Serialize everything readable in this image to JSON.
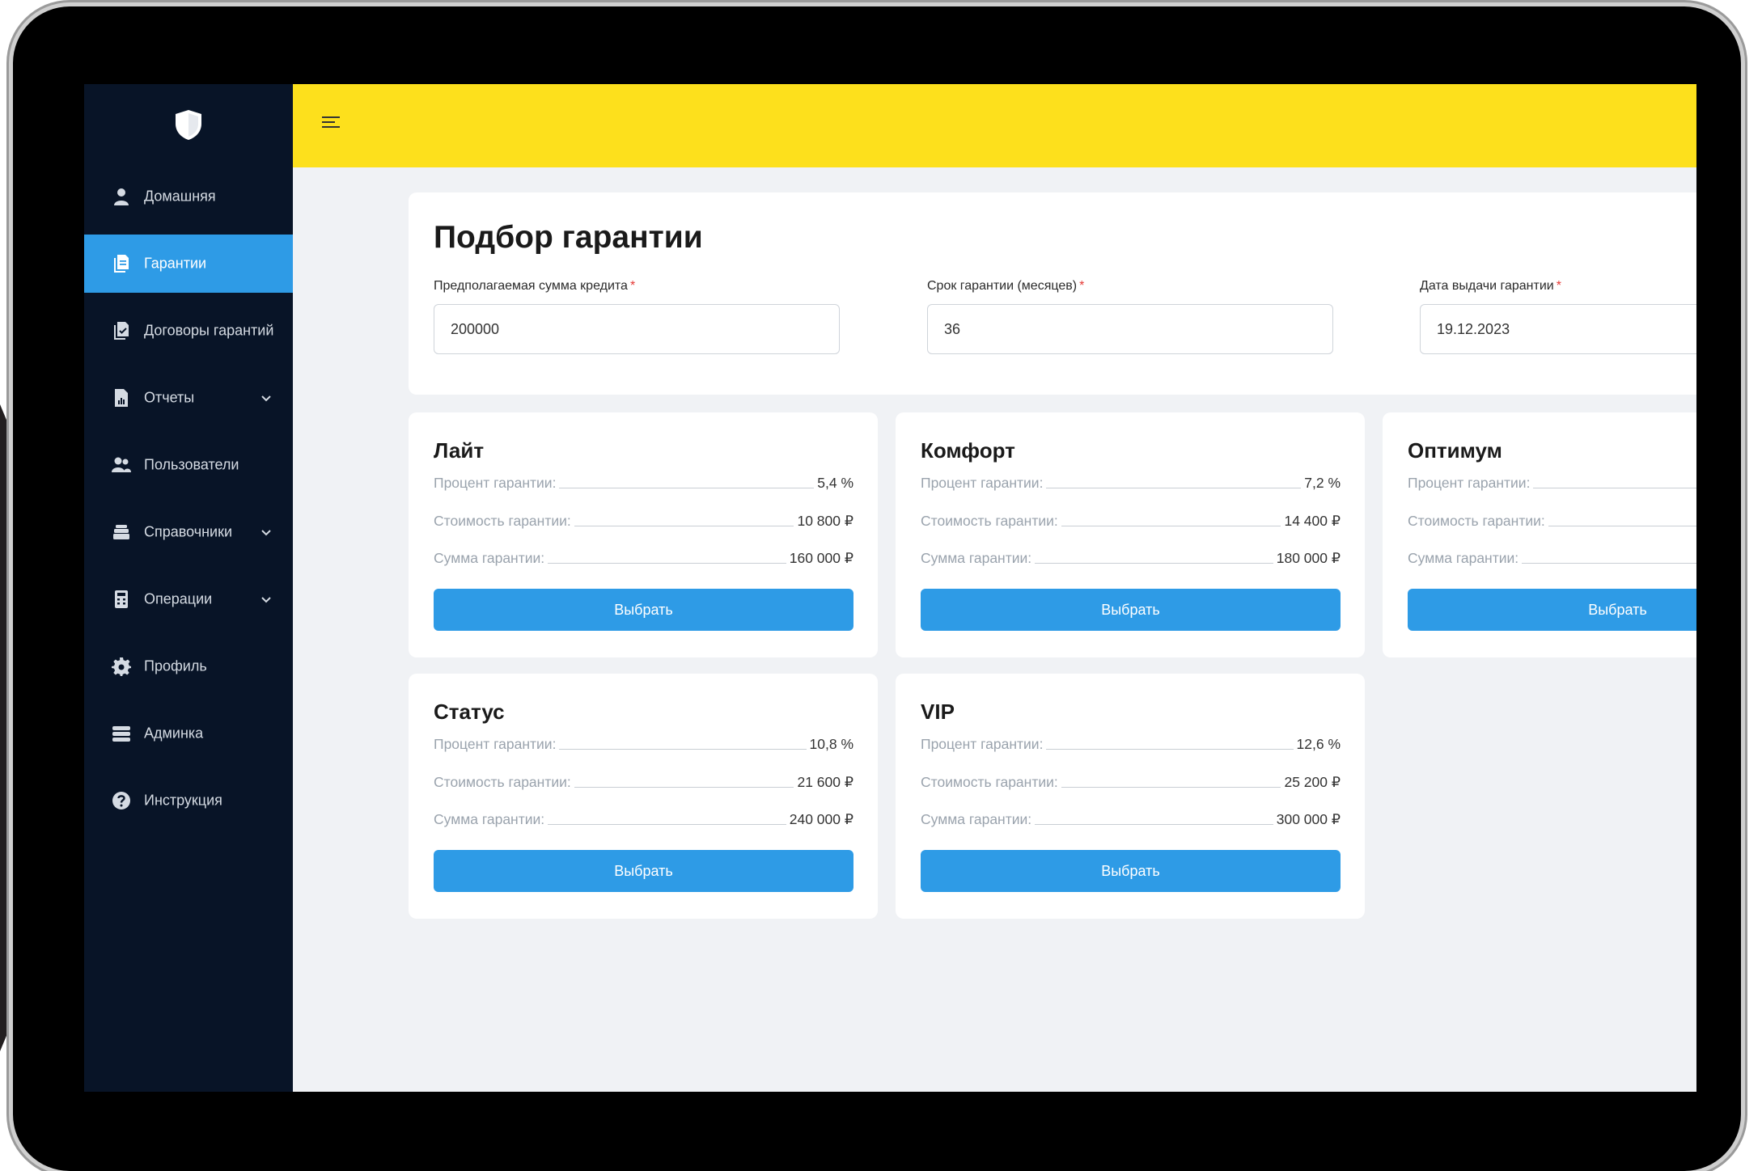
{
  "app": {
    "brand_icon": "shield-icon",
    "accent_color": "#2e9be6",
    "topbar_color": "#fde01c",
    "sidebar_color": "#081427"
  },
  "sidebar": {
    "items": [
      {
        "label": "Домашняя",
        "icon": "user-icon",
        "active": false,
        "has_submenu": false
      },
      {
        "label": "Гарантии",
        "icon": "documents-icon",
        "active": true,
        "has_submenu": false
      },
      {
        "label": "Договоры гарантий",
        "icon": "contracts-icon",
        "active": false,
        "has_submenu": false
      },
      {
        "label": "Отчеты",
        "icon": "report-icon",
        "active": false,
        "has_submenu": true
      },
      {
        "label": "Пользователи",
        "icon": "users-icon",
        "active": false,
        "has_submenu": false
      },
      {
        "label": "Справочники",
        "icon": "books-icon",
        "active": false,
        "has_submenu": true
      },
      {
        "label": "Операции",
        "icon": "calculator-icon",
        "active": false,
        "has_submenu": true
      },
      {
        "label": "Профиль",
        "icon": "gear-icon",
        "active": false,
        "has_submenu": false
      },
      {
        "label": "Админка",
        "icon": "server-icon",
        "active": false,
        "has_submenu": false
      },
      {
        "label": "Инструкция",
        "icon": "question-icon",
        "active": false,
        "has_submenu": false
      }
    ]
  },
  "form": {
    "title": "Подбор гарантии",
    "required_mark": "*",
    "fields": [
      {
        "label": "Предполагаемая сумма кредита",
        "value": "200000"
      },
      {
        "label": "Срок гарантии (месяцев)",
        "value": "36"
      },
      {
        "label": "Дата выдачи гарантии",
        "value": "19.12.2023"
      }
    ]
  },
  "row_labels": {
    "percent": "Процент гарантии:",
    "cost": "Стоимость гарантии:",
    "sum": "Сумма гарантии:"
  },
  "select_label": "Выбрать",
  "tariffs": [
    {
      "name": "Лайт",
      "percent": "5,4 %",
      "cost": "10 800 ₽",
      "sum": "160 000 ₽"
    },
    {
      "name": "Комфорт",
      "percent": "7,2 %",
      "cost": "14 400 ₽",
      "sum": "180 000 ₽"
    },
    {
      "name": "Оптимум",
      "percent": "",
      "cost": "",
      "sum": ""
    },
    {
      "name": "Статус",
      "percent": "10,8 %",
      "cost": "21 600 ₽",
      "sum": "240 000 ₽"
    },
    {
      "name": "VIP",
      "percent": "12,6 %",
      "cost": "25 200 ₽",
      "sum": "300 000 ₽"
    }
  ]
}
